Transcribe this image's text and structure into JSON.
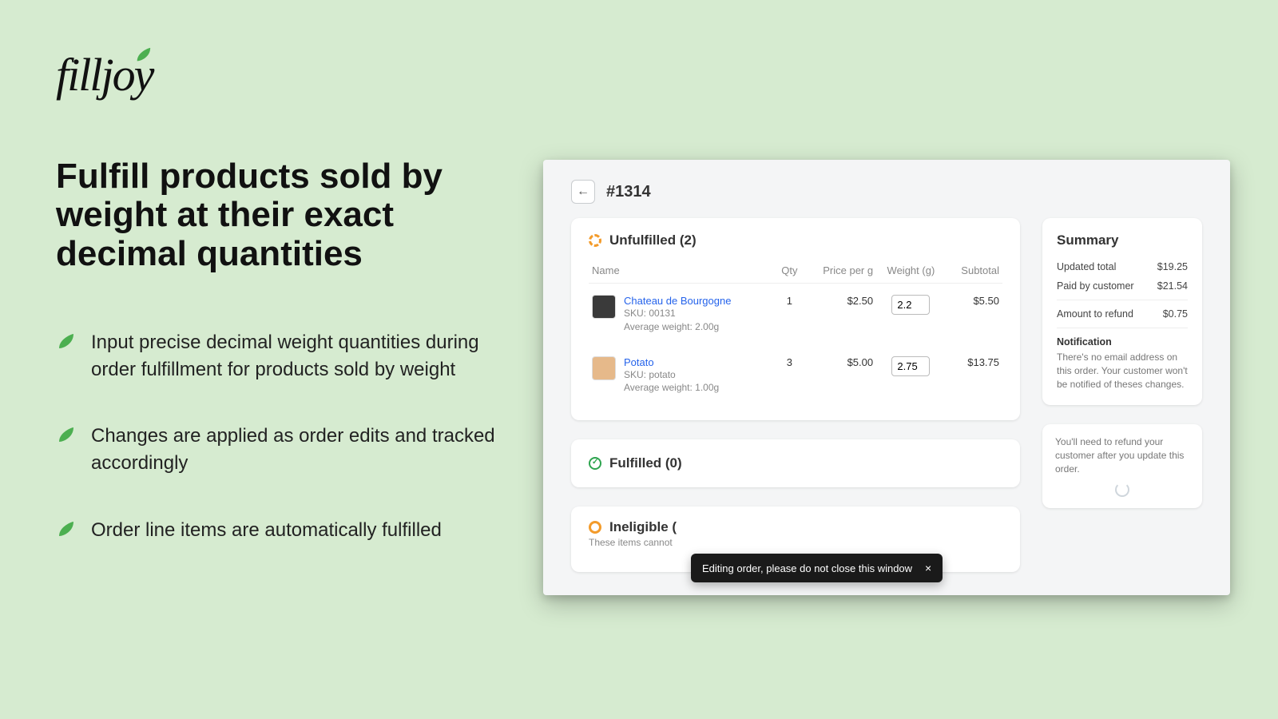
{
  "brand": {
    "name": "filljoy"
  },
  "headline": "Fulfill products sold by weight at their exact decimal quantities",
  "bullets": [
    "Input precise decimal weight quantities during order fulfillment for products sold by weight",
    "Changes are applied as order edits and tracked accordingly",
    "Order line items are automatically fulfilled"
  ],
  "order": {
    "number": "#1314",
    "unfulfilled": {
      "title": "Unfulfilled (2)",
      "columns": {
        "name": "Name",
        "qty": "Qty",
        "price": "Price per g",
        "weight": "Weight (g)",
        "subtotal": "Subtotal"
      },
      "items": [
        {
          "name": "Chateau de Bourgogne",
          "sku": "SKU: 00131",
          "avg": "Average weight: 2.00g",
          "qty": "1",
          "price": "$2.50",
          "weight": "2.2",
          "subtotal": "$5.50",
          "img_bg": "#3a3a3a"
        },
        {
          "name": "Potato",
          "sku": "SKU: potato",
          "avg": "Average weight: 1.00g",
          "qty": "3",
          "price": "$5.00",
          "weight": "2.75",
          "subtotal": "$13.75",
          "img_bg": "#e6b98a"
        }
      ]
    },
    "fulfilled": {
      "title": "Fulfilled (0)"
    },
    "ineligible": {
      "title": "Ineligible (",
      "sub": "These items cannot"
    }
  },
  "summary": {
    "title": "Summary",
    "rows": [
      {
        "label": "Updated total",
        "value": "$19.25"
      },
      {
        "label": "Paid by customer",
        "value": "$21.54"
      },
      {
        "label": "Amount to refund",
        "value": "$0.75"
      }
    ],
    "notification_h": "Notification",
    "notification": "There's no email address on this order. Your customer won't be notified of theses changes.",
    "refund_hint": "You'll need to refund your customer after you update this order."
  },
  "toast": {
    "text": "Editing order, please do not close this window",
    "close": "×"
  }
}
